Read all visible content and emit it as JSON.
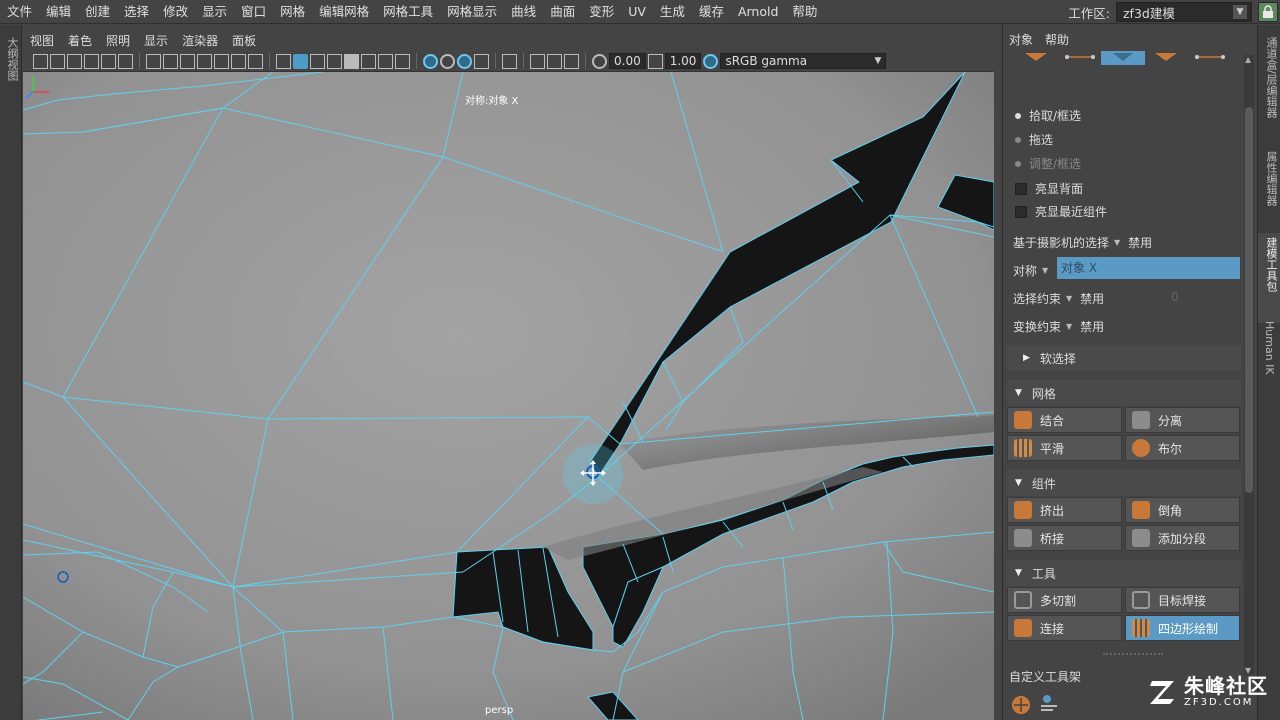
{
  "menubar": {
    "items": [
      "文件",
      "编辑",
      "创建",
      "选择",
      "修改",
      "显示",
      "窗口",
      "网格",
      "编辑网格",
      "网格工具",
      "网格显示",
      "曲线",
      "曲面",
      "变形",
      "UV",
      "生成",
      "缓存",
      "Arnold",
      "帮助"
    ],
    "workspace_label": "工作区:",
    "workspace_value": "zf3d建模"
  },
  "left_dock": {
    "tab": "大纲视图"
  },
  "viewport": {
    "menus": [
      "视图",
      "着色",
      "照明",
      "显示",
      "渲染器",
      "面板"
    ],
    "exposure": "0.00",
    "gamma": "1.00",
    "color_space": "sRGB gamma",
    "symmetry_label": "对称:对象 X",
    "camera_label": "persp"
  },
  "panel": {
    "menus": [
      "对象",
      "帮助"
    ],
    "radio_options": [
      {
        "label": "拾取/框选",
        "state": "on"
      },
      {
        "label": "拖选",
        "state": "off"
      },
      {
        "label": "调整/框选",
        "state": "dim"
      }
    ],
    "checkboxes": [
      "亮显背面",
      "亮显最近组件"
    ],
    "camera_select": {
      "label": "基于摄影机的选择",
      "value": "禁用"
    },
    "symmetry": {
      "label": "对称",
      "value": "对象 X"
    },
    "select_constraint": {
      "label": "选择约束",
      "value": "禁用",
      "extra": "0"
    },
    "transform_constraint": {
      "label": "变换约束",
      "value": "禁用"
    },
    "soft_select": "软选择",
    "sections": [
      {
        "title": "网格",
        "buttons": [
          {
            "label": "结合",
            "icon": "combine-icon"
          },
          {
            "label": "分离",
            "icon": "separate-icon"
          },
          {
            "label": "平滑",
            "icon": "smooth-icon"
          },
          {
            "label": "布尔",
            "icon": "boolean-icon"
          }
        ]
      },
      {
        "title": "组件",
        "buttons": [
          {
            "label": "挤出",
            "icon": "extrude-icon"
          },
          {
            "label": "倒角",
            "icon": "bevel-icon"
          },
          {
            "label": "桥接",
            "icon": "bridge-icon"
          },
          {
            "label": "添加分段",
            "icon": "add-divisions-icon"
          }
        ]
      },
      {
        "title": "工具",
        "buttons": [
          {
            "label": "多切割",
            "icon": "multi-cut-icon"
          },
          {
            "label": "目标焊接",
            "icon": "target-weld-icon"
          },
          {
            "label": "连接",
            "icon": "connect-icon"
          },
          {
            "label": "四边形绘制",
            "icon": "quad-draw-icon",
            "active": true
          }
        ]
      }
    ],
    "shelf_label": "自定义工具架"
  },
  "right_dock": {
    "tabs": [
      "通道盒/层编辑器",
      "属性编辑器",
      "建模工具包",
      "Human IK"
    ]
  },
  "watermark": {
    "cn": "朱峰社区",
    "en": "ZF3D.COM"
  },
  "colors": {
    "accent": "#5a9ac5",
    "wire": "#5fd0f0",
    "hole": "#151515"
  }
}
